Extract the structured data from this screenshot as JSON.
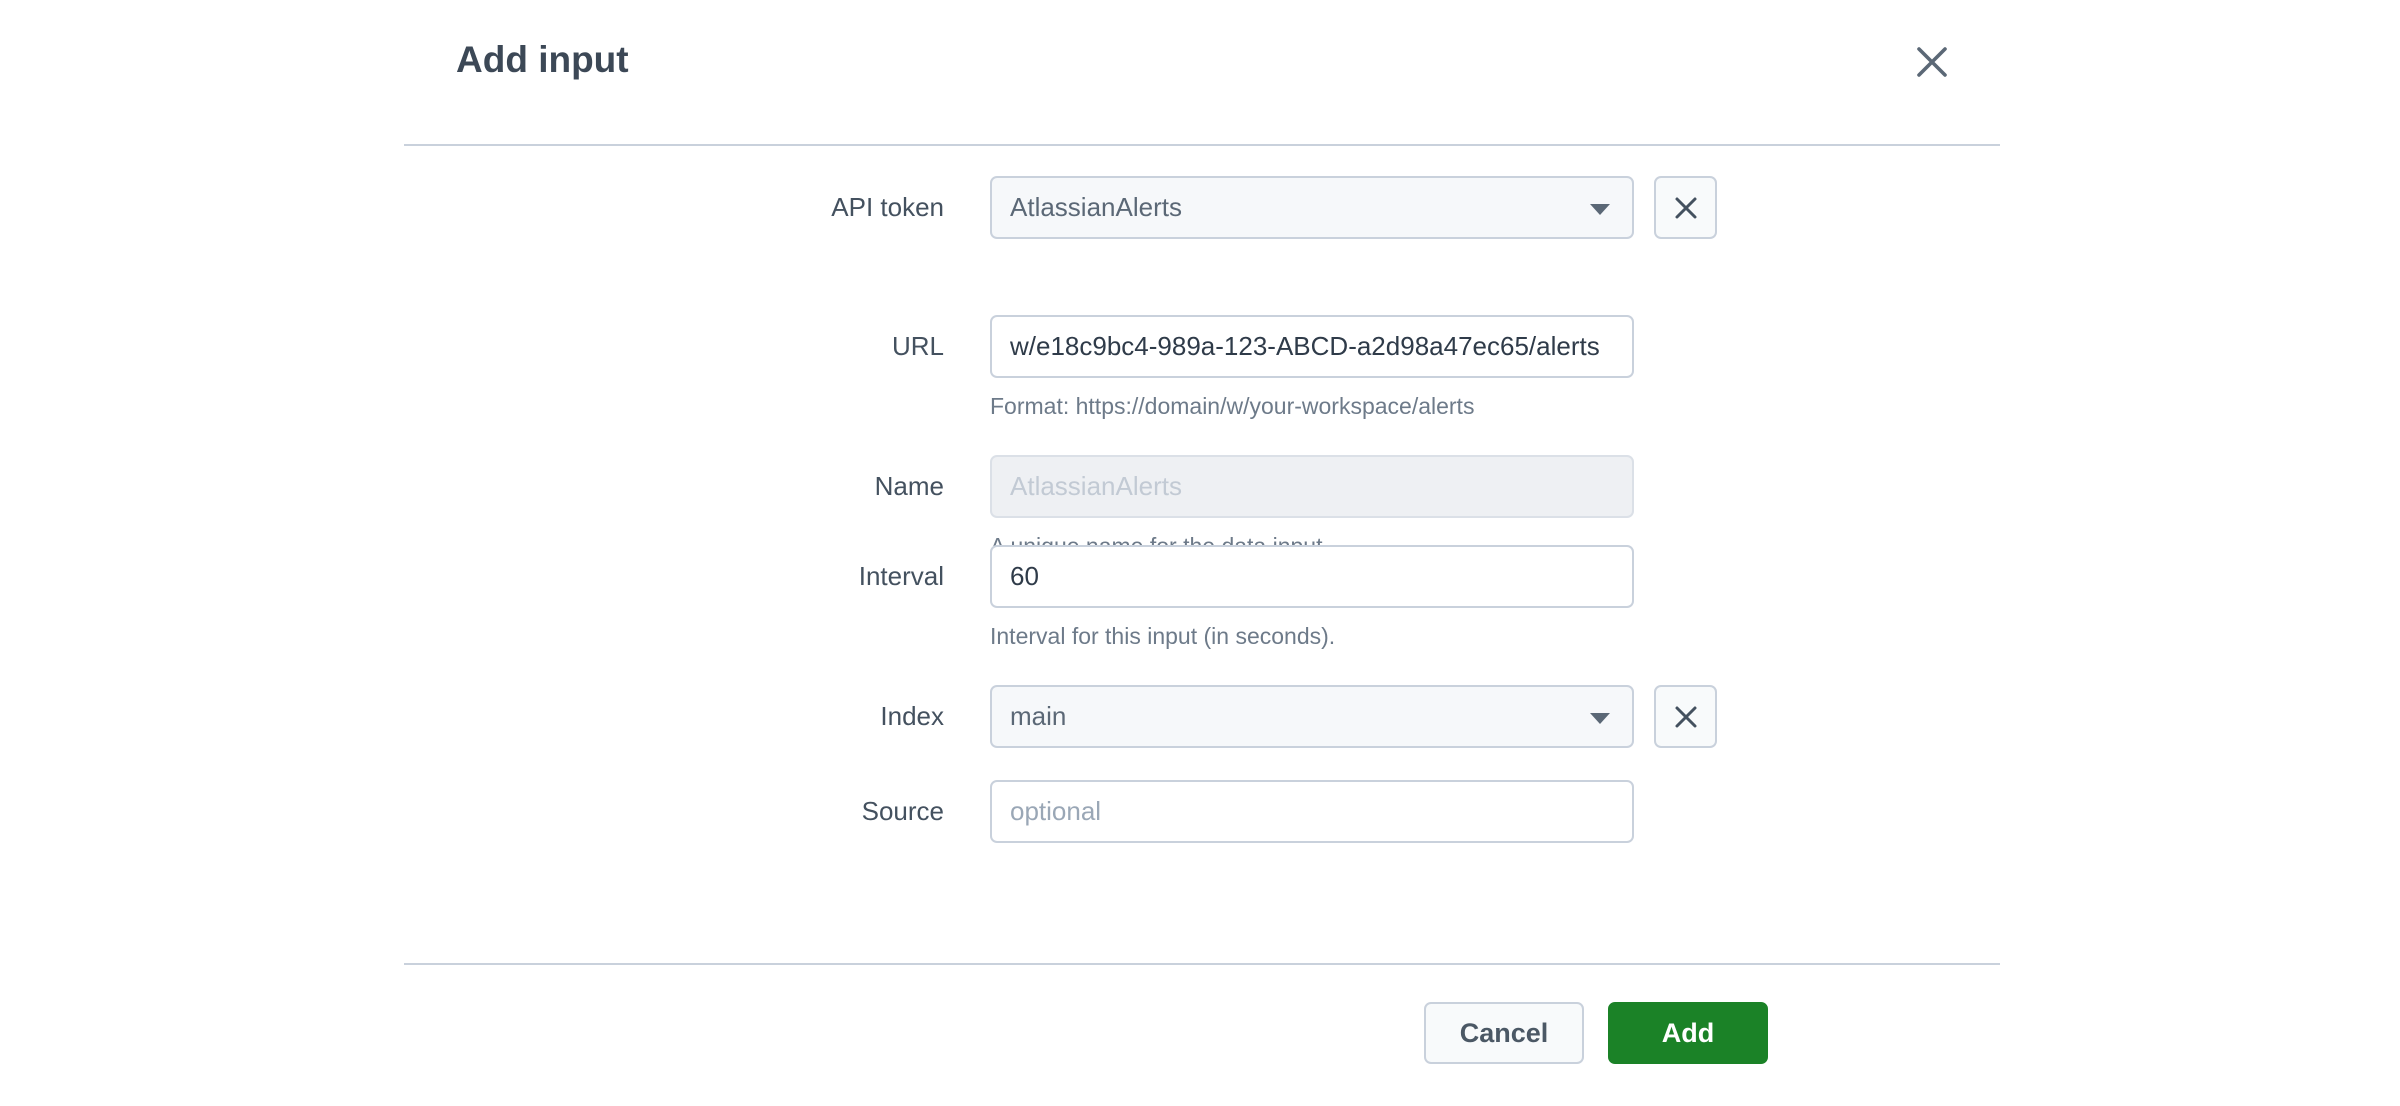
{
  "dialog": {
    "title": "Add input",
    "close_icon": "close-icon"
  },
  "form": {
    "api_token": {
      "label": "API token",
      "type": "select",
      "value": "AtlassianAlerts",
      "clear_icon": "close-icon",
      "caret_icon": "chevron-down-icon"
    },
    "url": {
      "label": "URL",
      "type": "text",
      "value": "w/e18c9bc4-989a-123-ABCD-a2d98a47ec65/alerts",
      "hint": "Format: https://domain/w/your-workspace/alerts"
    },
    "name": {
      "label": "Name",
      "type": "text",
      "value": "",
      "placeholder": "AtlassianAlerts",
      "hint": "A unique name for the data input.",
      "disabled": "true"
    },
    "interval": {
      "label": "Interval",
      "type": "text",
      "value": "60",
      "hint": "Interval for this input (in seconds)."
    },
    "index": {
      "label": "Index",
      "type": "select",
      "value": "main",
      "clear_icon": "close-icon",
      "caret_icon": "chevron-down-icon"
    },
    "source": {
      "label": "Source",
      "type": "text",
      "value": "",
      "placeholder": "optional"
    }
  },
  "footer": {
    "cancel_label": "Cancel",
    "add_label": "Add"
  },
  "colors": {
    "primary_action": "#1b8227",
    "border": "#c9d1dc",
    "text": "#44515f",
    "hint_text": "#6d7a89",
    "disabled_bg": "#eef0f3",
    "select_bg": "#f6f8fa"
  }
}
